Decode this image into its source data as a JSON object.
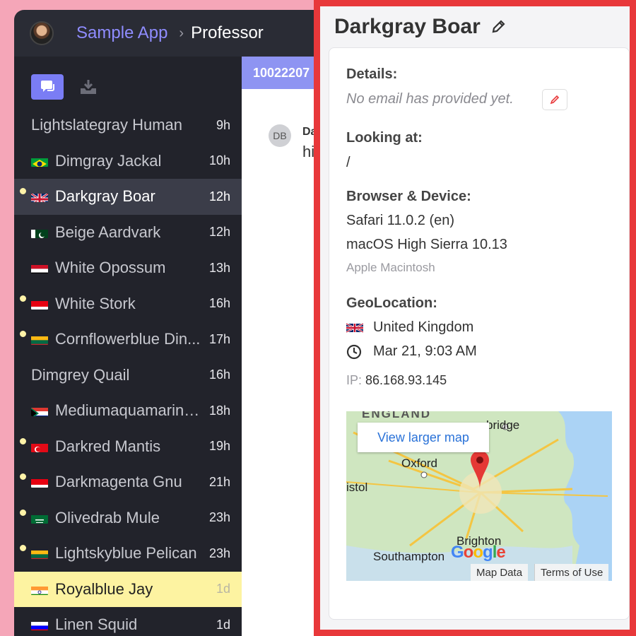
{
  "header": {
    "app_name": "Sample App",
    "breadcrumb_sep": "›",
    "page": "Professor"
  },
  "sidebar": {
    "tabs": [
      {
        "icon": "chat-bubbles-icon",
        "active": true
      },
      {
        "icon": "inbox-download-icon",
        "active": false
      }
    ],
    "conversations": [
      {
        "name": "Lightslategray Human",
        "time": "9h",
        "flag": "none",
        "unread": false
      },
      {
        "name": "Dimgray Jackal",
        "time": "10h",
        "flag": "br",
        "unread": false
      },
      {
        "name": "Darkgray Boar",
        "time": "12h",
        "flag": "gb",
        "unread": true,
        "active": true
      },
      {
        "name": "Beige Aardvark",
        "time": "12h",
        "flag": "pk",
        "unread": false
      },
      {
        "name": "White Opossum",
        "time": "13h",
        "flag": "eg",
        "unread": false
      },
      {
        "name": "White Stork",
        "time": "16h",
        "flag": "id",
        "unread": true
      },
      {
        "name": "Cornflowerblue Din...",
        "time": "17h",
        "flag": "lt",
        "unread": true
      },
      {
        "name": "Dimgrey Quail",
        "time": "16h",
        "flag": "none",
        "unread": false
      },
      {
        "name": "Mediumaquamarine...",
        "time": "18h",
        "flag": "za",
        "unread": false
      },
      {
        "name": "Darkred Mantis",
        "time": "19h",
        "flag": "tr",
        "unread": true
      },
      {
        "name": "Darkmagenta Gnu",
        "time": "21h",
        "flag": "id",
        "unread": true
      },
      {
        "name": "Olivedrab Mule",
        "time": "23h",
        "flag": "sa",
        "unread": true
      },
      {
        "name": "Lightskyblue Pelican",
        "time": "23h",
        "flag": "lt",
        "unread": true
      },
      {
        "name": "Royalblue Jay",
        "time": "1d",
        "flag": "in",
        "unread": false,
        "selected": true
      },
      {
        "name": "Linen Squid",
        "time": "1d",
        "flag": "si",
        "unread": false
      }
    ]
  },
  "chat": {
    "conversation_id": "10022207",
    "avatar_initials": "DB",
    "sender": "Da",
    "message": "hi"
  },
  "details": {
    "title": "Darkgray Boar",
    "details_label": "Details:",
    "email_text": "No email has provided yet.",
    "looking_label": "Looking at:",
    "looking_value": "/",
    "browser_label": "Browser & Device:",
    "browser": "Safari 11.0.2 (en)",
    "os": "macOS High Sierra 10.13",
    "device": "Apple Macintosh",
    "geo_label": "GeoLocation:",
    "country": "United Kingdom",
    "local_time": "Mar 21, 9:03 AM",
    "ip_label": "IP:",
    "ip": "86.168.93.145"
  },
  "map": {
    "view_larger": "View larger map",
    "labels": {
      "england": "ENGLAND",
      "cambridge": "bridge",
      "oxford": "Oxford",
      "bristol": "istol",
      "brighton": "Brighton",
      "southampton": "Southampton"
    },
    "google": "Google",
    "map_data": "Map Data",
    "terms": "Terms of Use"
  },
  "colors": {
    "accent": "#8e94f2",
    "panel_border": "#e8383a",
    "background": "#f5a6b8",
    "sidebar": "#22232b"
  }
}
